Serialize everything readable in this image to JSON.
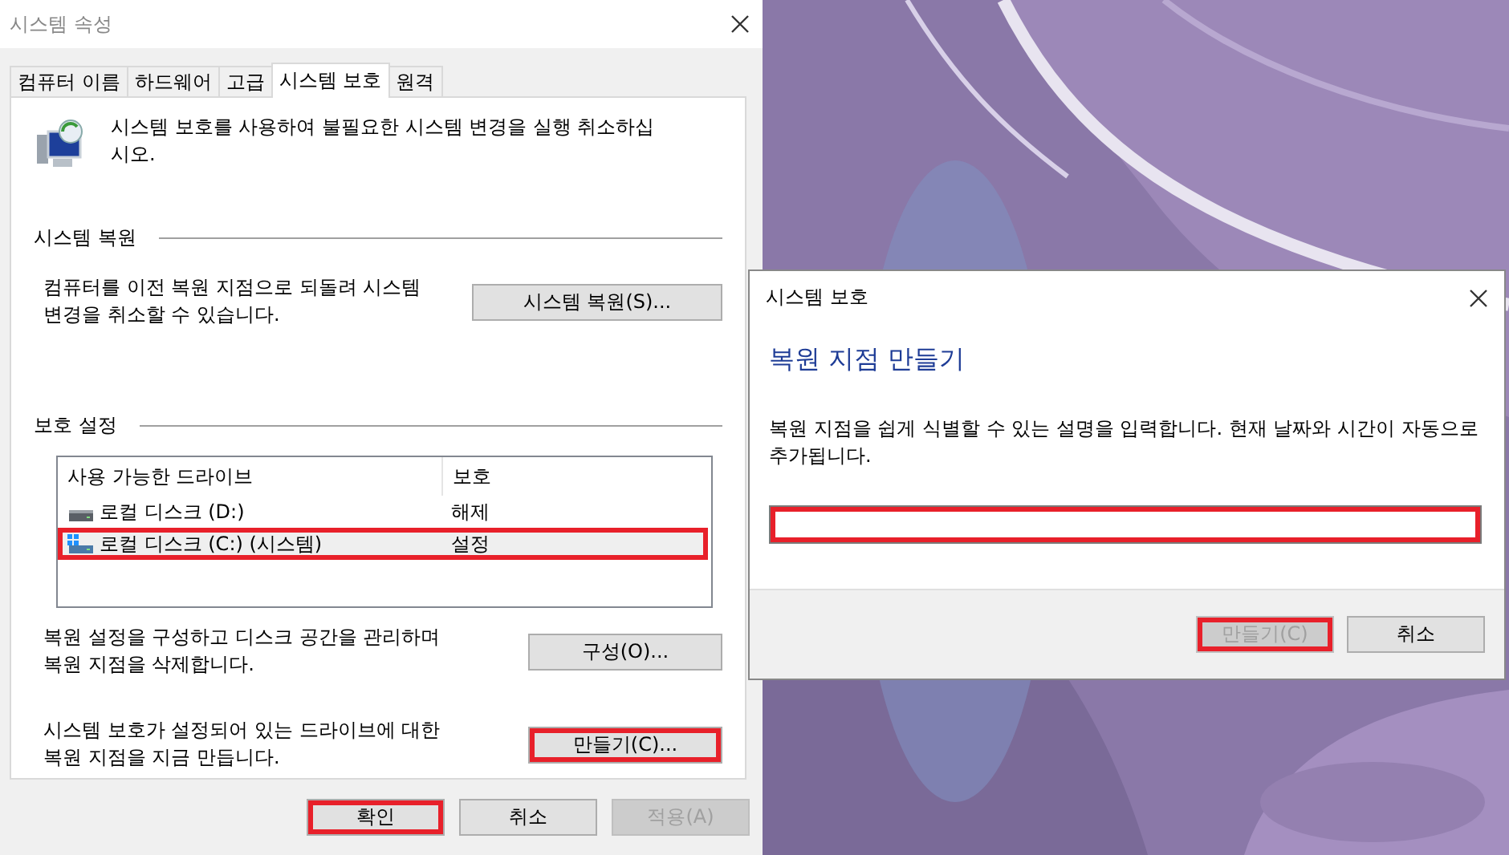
{
  "window": {
    "title": "시스템 속성"
  },
  "tabs": [
    {
      "label": "컴퓨터 이름",
      "selected": false
    },
    {
      "label": "하드웨어",
      "selected": false
    },
    {
      "label": "고급",
      "selected": false
    },
    {
      "label": "시스템 보호",
      "selected": true
    },
    {
      "label": "원격",
      "selected": false
    }
  ],
  "intro": "시스템 보호를 사용하여 불필요한 시스템 변경을 실행 취소하십시오.",
  "restore_section": {
    "heading": "시스템 복원",
    "description": "컴퓨터를 이전 복원 지점으로 되돌려 시스템 변경을 취소할 수 있습니다.",
    "button": {
      "label": "시스템 복원(S)...",
      "highlighted": false
    }
  },
  "protection_section": {
    "heading": "보호 설정",
    "columns": [
      "사용 가능한 드라이브",
      "보호"
    ],
    "drives": [
      {
        "name": "로컬 디스크 (D:)",
        "protection": "해제",
        "kind": "disk",
        "selected": false,
        "highlighted": false
      },
      {
        "name": "로컬 디스크 (C:) (시스템)",
        "protection": "설정",
        "kind": "system-disk",
        "selected": true,
        "highlighted": true
      }
    ],
    "configure": {
      "description": "복원 설정을 구성하고 디스크 공간을 관리하며 복원 지점을 삭제합니다.",
      "button": {
        "label": "구성(O)...",
        "highlighted": false
      }
    },
    "create": {
      "description": "시스템 보호가 설정되어 있는 드라이브에 대한 복원 지점을 지금 만듭니다.",
      "button": {
        "label": "만들기(C)...",
        "highlighted": true
      }
    }
  },
  "buttons": [
    {
      "label": "확인",
      "disabled": false,
      "highlighted": true
    },
    {
      "label": "취소",
      "disabled": false,
      "highlighted": false
    },
    {
      "label": "적용(A)",
      "disabled": true,
      "highlighted": false
    }
  ],
  "create_dialog": {
    "title": "시스템 보호",
    "heading": "복원 지점 만들기",
    "description": "복원 지점을 쉽게 식별할 수 있는 설명을 입력합니다. 현재 날짜와 시간이 자동으로 추가됩니다.",
    "input": {
      "highlighted": true
    },
    "buttons": [
      {
        "label": "만들기(C)",
        "disabled": true,
        "highlighted": true
      },
      {
        "label": "취소",
        "disabled": false,
        "highlighted": false
      }
    ]
  }
}
